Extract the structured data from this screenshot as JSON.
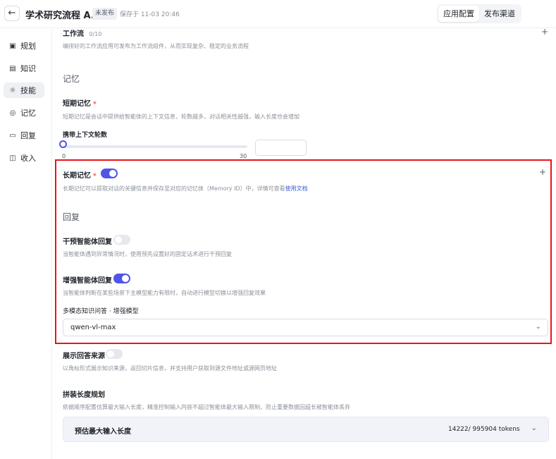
{
  "header": {
    "back_icon": "←",
    "title": "学术研究流程 A...",
    "status": "未发布",
    "save_time": "保存于 11-03 20:46",
    "tabs": [
      "应用配置",
      "发布渠道"
    ],
    "active_tab": "应用配置"
  },
  "sidebar": {
    "items": [
      {
        "label": "规划",
        "icon": "plan-icon",
        "glyph": "▣"
      },
      {
        "label": "知识",
        "icon": "knowledge-icon",
        "glyph": "▤"
      },
      {
        "label": "技能",
        "icon": "skill-icon",
        "glyph": "☼"
      },
      {
        "label": "记忆",
        "icon": "memory-icon",
        "glyph": "◎"
      },
      {
        "label": "回复",
        "icon": "reply-icon",
        "glyph": "▭"
      },
      {
        "label": "收入",
        "icon": "income-icon",
        "glyph": "◫"
      }
    ],
    "active": "技能"
  },
  "workflow": {
    "title": "工作流",
    "count": "0/10",
    "desc": "编排好的工作流应用可发布为工作流组件，从而实现复杂、稳定的业务流程"
  },
  "memory": {
    "section_title": "记忆",
    "short_term": {
      "title": "短期记忆",
      "required": "*",
      "desc": "短期记忆是会话中提供给智能体的上下文信息，轮数越多，对话相关性越强，输入长度也会增加",
      "rounds_label": "携带上下文轮数",
      "slider_min": "0",
      "slider_max": "30",
      "slider_value": 0
    },
    "long_term": {
      "title": "长期记忆",
      "required": "*",
      "enabled": true,
      "desc": "长期记忆可以提取对话的关键信息并保存至对应的记忆体（Memory ID）中，详情可查看",
      "link": "使用文档"
    }
  },
  "reply": {
    "section_title": "回复",
    "intervene": {
      "title": "干预智能体回复",
      "enabled": false,
      "desc": "当智能体遇到异常情况时，使用预先设置好的固定话术进行干预回复"
    },
    "enhance": {
      "title": "增强智能体回复",
      "enabled": true,
      "desc": "当智能体判断在某些场景下主模型能力有限时，自动进行模型切换以增强回复效果",
      "model_label": "多模态知识问答 · 增强模型",
      "model_value": "qwen-vl-max"
    },
    "show_source": {
      "title": "展示回答来源",
      "enabled": false,
      "desc": "以角标形式展示知识来源，返回切片信息，并支持用户获取到源文件地址或源网页地址"
    }
  },
  "length_plan": {
    "title": "拼装长度规划",
    "desc": "依据顺序配置估算最大输入长度，精准控制输入内容不超过智能体最大输入限制，防止重要数据因超长被智能体丢弃",
    "estimate_label": "预估最大输入长度",
    "estimate_value": "14222/ 995904 tokens"
  },
  "colors": {
    "accent": "#4f55e6",
    "highlight_border": "#e8141b",
    "required": "#f54a45",
    "link": "#3b5bdb"
  }
}
